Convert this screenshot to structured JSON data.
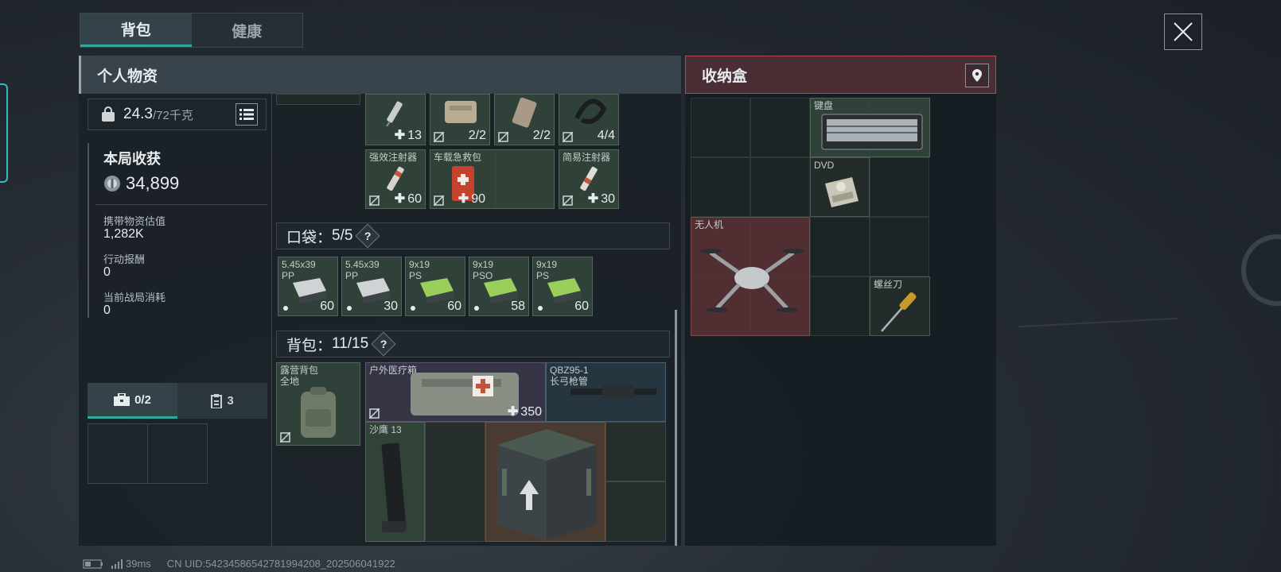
{
  "tabs": [
    {
      "label": "背包",
      "active": true
    },
    {
      "label": "健康",
      "active": false
    }
  ],
  "left": {
    "title": "个人物资",
    "weight": {
      "value": "24.3",
      "max": "/72千克"
    },
    "stats": {
      "title": "本局收获",
      "coins": "34,899",
      "items": [
        {
          "label": "携带物资估值",
          "value": "1,282K"
        },
        {
          "label": "行动报酬",
          "value": "0"
        },
        {
          "label": "当前战局消耗",
          "value": "0"
        }
      ]
    },
    "sub_tabs": [
      {
        "label": "0/2",
        "icon": "briefcase-icon",
        "active": true
      },
      {
        "label": "3",
        "icon": "clipboard-icon",
        "active": false
      }
    ]
  },
  "medical_items": [
    {
      "name": "",
      "qty": "13",
      "plus": true,
      "noins": false
    },
    {
      "name": "",
      "qty": "2/2",
      "plus": false,
      "noins": true
    },
    {
      "name": "",
      "qty": "2/2",
      "plus": false,
      "noins": true
    },
    {
      "name": "",
      "qty": "4/4",
      "plus": false,
      "noins": true
    },
    {
      "name": "强效注射器",
      "qty": "60",
      "plus": true,
      "noins": true
    },
    {
      "name": "车载急救包",
      "qty": "90",
      "plus": true,
      "noins": true
    },
    {
      "name": "简易注射器",
      "qty": "30",
      "plus": true,
      "noins": true
    }
  ],
  "pocket": {
    "label": "口袋：",
    "count": "5/5",
    "help": "?",
    "items": [
      {
        "name": "5.45x39",
        "sub": "PP",
        "qty": "60",
        "color": "#cfd3d6"
      },
      {
        "name": "5.45x39",
        "sub": "PP",
        "qty": "30",
        "color": "#cfd3d6"
      },
      {
        "name": "9x19",
        "sub": "PS",
        "qty": "60",
        "color": "#9ccf5a"
      },
      {
        "name": "9x19",
        "sub": "PSO",
        "qty": "58",
        "color": "#9ccf5a"
      },
      {
        "name": "9x19",
        "sub": "PS",
        "qty": "60",
        "color": "#9ccf5a"
      }
    ]
  },
  "backpack": {
    "label": "背包：",
    "count": "11/15",
    "help": "?",
    "bag_name": "露营背包",
    "bag_sub": "全地",
    "items": {
      "medkit": {
        "name": "户外医疗箱",
        "qty": "350"
      },
      "barrel": {
        "name": "QBZ95-1",
        "sub": "长弓枪管"
      },
      "magazine": {
        "name": "沙鹰 13"
      }
    }
  },
  "right": {
    "title": "收纳盒",
    "items": {
      "keyboard": {
        "name": "键盘"
      },
      "dvd": {
        "name": "DVD"
      },
      "drone": {
        "name": "无人机"
      },
      "screwdriver": {
        "name": "螺丝刀"
      }
    }
  },
  "status": {
    "ping": "39ms",
    "uid": "CN UID:54234586542781994208_202506041922"
  },
  "colors": {
    "accent": "#2fa89b",
    "storage_border": "#b5455a"
  }
}
